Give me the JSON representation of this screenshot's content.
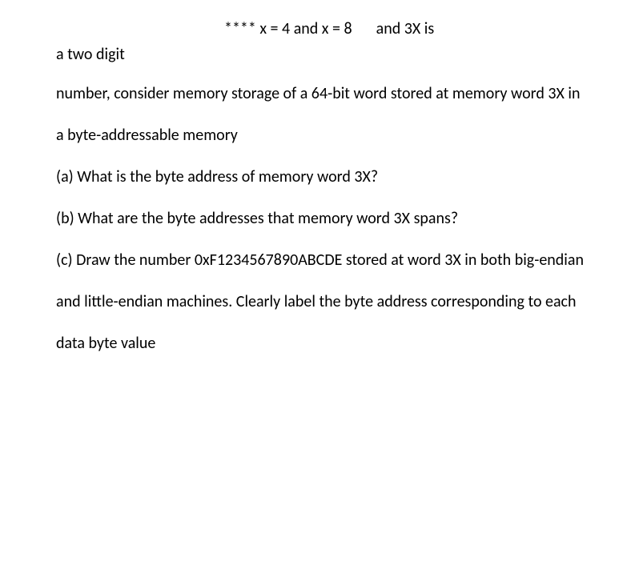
{
  "lines": {
    "l1a": "**** x = 4 and x = 8",
    "l1b": "and 3X is",
    "l2": "a two digit",
    "p1": "number, consider memory storage of a 64-bit word stored at memory word 3X in",
    "p2": "a byte-addressable memory",
    "p3": "(a) What is the byte address of memory word 3X?",
    "p4": "(b) What are the byte addresses that memory word 3X spans?",
    "p5": "(c) Draw the number 0xF1234567890ABCDE stored at word 3X in both big-endian",
    "p6": "and little-endian machines. Clearly label the byte address corresponding to each",
    "p7": "data byte value"
  }
}
